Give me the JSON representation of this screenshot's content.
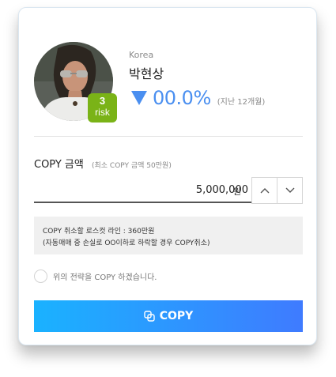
{
  "profile": {
    "country": "Korea",
    "name": "박현상",
    "risk_number": "3",
    "risk_label": "risk",
    "change_value": "00.0%",
    "change_direction_icon": "triangle-down-icon",
    "change_period": "(지난 12개월)"
  },
  "copy_amount": {
    "title": "COPY 금액",
    "subtitle": "(최소 COPY 금액 50만원)",
    "value": "5,000,000",
    "unit": "원"
  },
  "info": {
    "line1": "COPY 취소할 로스컷 라인 : 360만원",
    "line2": "(자동매매 중 손실로 OO이하로 하락할 경우 COPY취소)"
  },
  "agreement": {
    "label": "위의 전략을 COPY 하겠습니다.",
    "checked": false
  },
  "action": {
    "copy_label": "COPY",
    "copy_icon": "copy-icon"
  },
  "colors": {
    "accent": "#4a8ff0",
    "risk_badge": "#7ab317",
    "button_start": "#1ab2ff",
    "button_end": "#3f7bff"
  }
}
